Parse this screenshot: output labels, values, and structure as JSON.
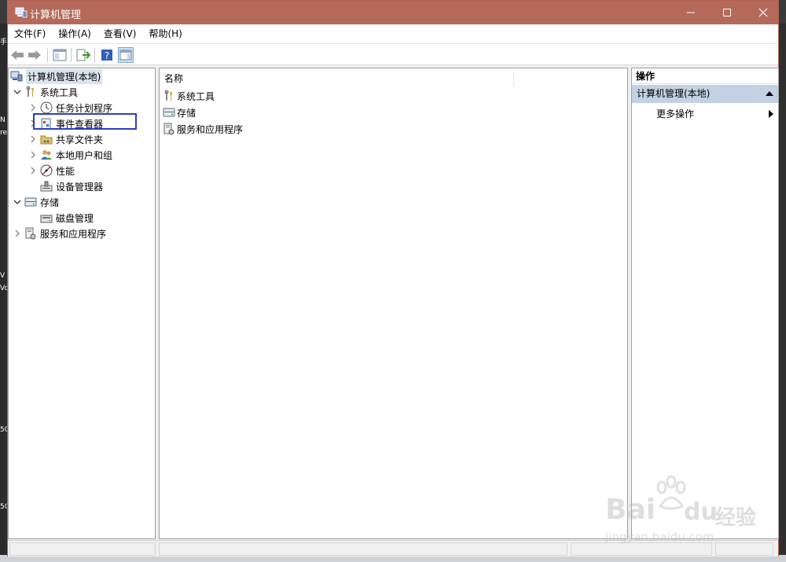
{
  "window": {
    "title": "计算机管理",
    "buttons": {
      "minimize": "—",
      "maximize": "☐",
      "close": "✕"
    }
  },
  "menu": {
    "items": [
      "文件(F)",
      "操作(A)",
      "查看(V)",
      "帮助(H)"
    ]
  },
  "toolbar": {
    "icons": [
      "back-arrow-icon",
      "forward-arrow-icon",
      "show-hide-tree-icon",
      "export-list-icon",
      "help-icon",
      "show-hide-action-pane-icon"
    ]
  },
  "tree": {
    "root": "计算机管理(本地)",
    "system_tools": "系统工具",
    "task_scheduler": "任务计划程序",
    "event_viewer": "事件查看器",
    "shared_folders": "共享文件夹",
    "local_users": "本地用户和组",
    "performance": "性能",
    "device_manager": "设备管理器",
    "storage": "存储",
    "disk_management": "磁盘管理",
    "services_apps": "服务和应用程序"
  },
  "list": {
    "column_name": "名称",
    "rows": [
      "系统工具",
      "存储",
      "服务和应用程序"
    ]
  },
  "actions": {
    "header": "操作",
    "section": "计算机管理(本地)",
    "more": "更多操作"
  },
  "watermark": {
    "brand": "Bai",
    "brand2": "du",
    "cn": "经验",
    "url": "jingyan.baidu.com"
  },
  "desktop": {
    "fragments": [
      "手",
      "N",
      "re",
      "V",
      "Vo",
      "50",
      "50"
    ]
  },
  "colors": {
    "titlebar": "#b4695a",
    "selection": "#c2d2e4",
    "highlight_box": "#2b3fbf"
  }
}
